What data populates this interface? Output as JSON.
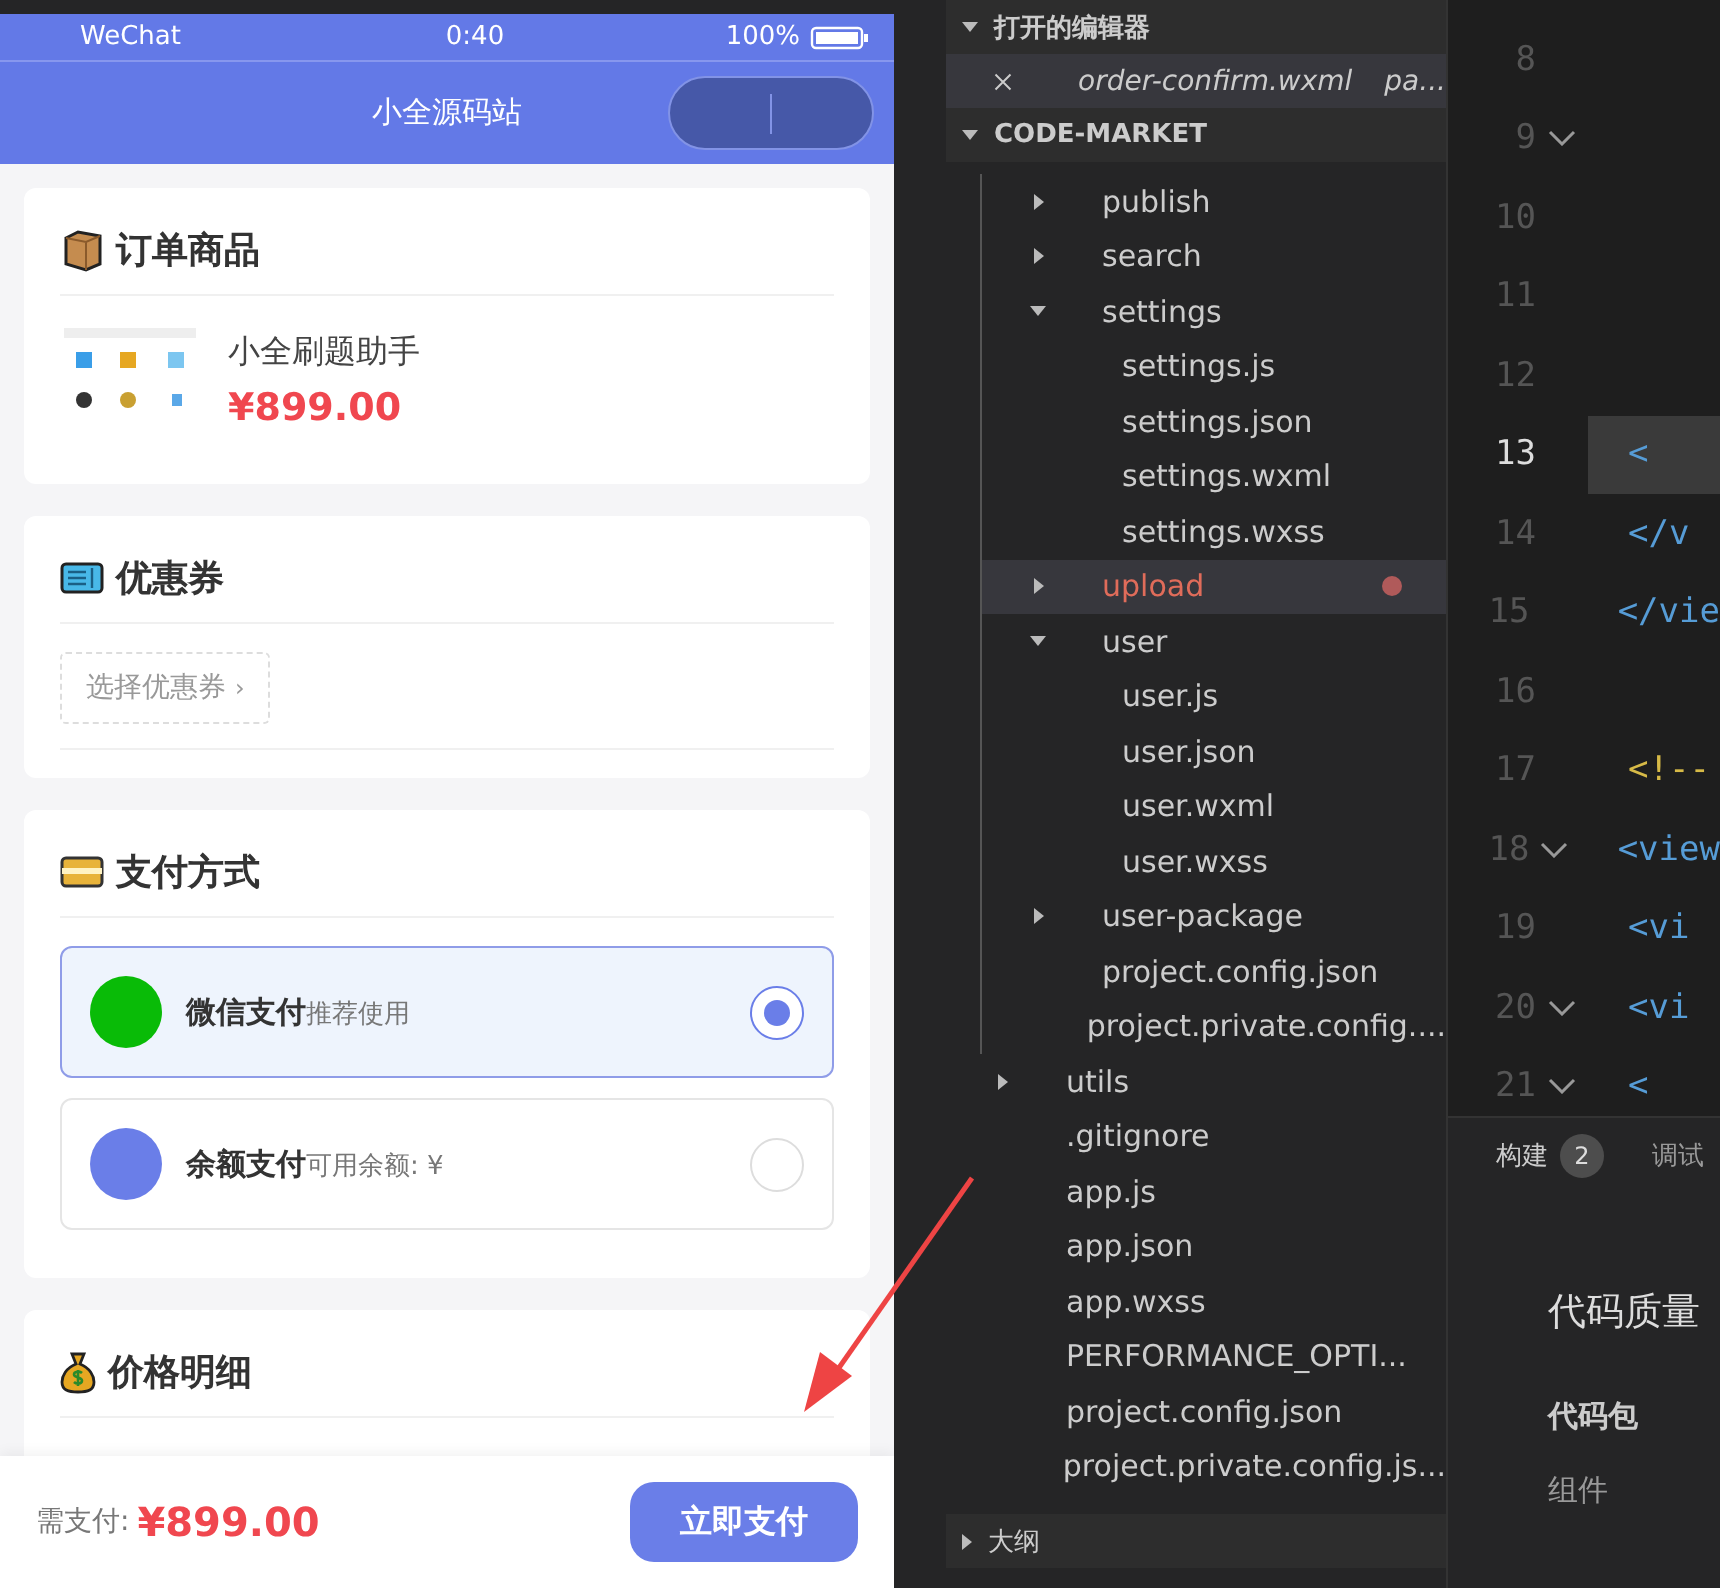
{
  "phone": {
    "status_bar": {
      "carrier": "WeChat",
      "time": "0:40",
      "battery": "100%"
    },
    "nav_title": "小全源码站",
    "sections": [
      {
        "kind": "product",
        "title": "订单商品",
        "product": {
          "name": "小全刷题助手",
          "price": "¥899.00"
        }
      },
      {
        "kind": "coupon",
        "title": "优惠券",
        "coupon_button": "选择优惠券",
        "chevron": "›"
      },
      {
        "kind": "payment",
        "title": "支付方式",
        "options": [
          {
            "name": "微信支付",
            "note": "推荐使用",
            "color": "#09bb07",
            "selected": true
          },
          {
            "name": "余额支付",
            "note": "可用余额: ¥",
            "color": "#6a7ee8",
            "selected": false
          }
        ]
      },
      {
        "kind": "price",
        "title": "价格明细"
      }
    ],
    "footer": {
      "label": "需支付:",
      "amount": "¥899.00",
      "pay_button": "立即支付"
    }
  },
  "explorer": {
    "open_editors": {
      "title": "打开的编辑器",
      "expanded": true,
      "files": [
        {
          "name": "order-confirm.wxml",
          "path": "pa..."
        }
      ]
    },
    "project": {
      "title": "CODE-MARKET",
      "expanded": true,
      "inner_items": [
        {
          "label": "publish",
          "kind": "folder",
          "expanded": false
        },
        {
          "label": "search",
          "kind": "folder",
          "expanded": false
        },
        {
          "label": "settings",
          "kind": "folder",
          "expanded": true,
          "children": [
            {
              "label": "settings.js",
              "kind": "file"
            },
            {
              "label": "settings.json",
              "kind": "file"
            },
            {
              "label": "settings.wxml",
              "kind": "file"
            },
            {
              "label": "settings.wxss",
              "kind": "file"
            }
          ]
        },
        {
          "label": "upload",
          "kind": "folder",
          "expanded": false,
          "modified": true
        },
        {
          "label": "user",
          "kind": "folder",
          "expanded": true,
          "children": [
            {
              "label": "user.js",
              "kind": "file"
            },
            {
              "label": "user.json",
              "kind": "file"
            },
            {
              "label": "user.wxml",
              "kind": "file"
            },
            {
              "label": "user.wxss",
              "kind": "file"
            }
          ]
        },
        {
          "label": "user-package",
          "kind": "folder",
          "expanded": false
        },
        {
          "label": "project.config.json",
          "kind": "file"
        },
        {
          "label": "project.private.config....",
          "kind": "file"
        }
      ],
      "outer_items": [
        {
          "label": "utils",
          "kind": "folder",
          "expanded": false
        },
        {
          "label": ".gitignore",
          "kind": "file"
        },
        {
          "label": "app.js",
          "kind": "file"
        },
        {
          "label": "app.json",
          "kind": "file"
        },
        {
          "label": "app.wxss",
          "kind": "file"
        },
        {
          "label": "PERFORMANCE_OPTI...",
          "kind": "file"
        },
        {
          "label": "project.config.json",
          "kind": "file"
        },
        {
          "label": "project.private.config.js...",
          "kind": "file"
        }
      ]
    },
    "outline": {
      "title": "大纲",
      "expanded": false
    }
  },
  "editor": {
    "lines": [
      {
        "number": "8",
        "fold": false,
        "current": false
      },
      {
        "number": "9",
        "fold": true,
        "current": false
      },
      {
        "number": "10",
        "fold": false,
        "current": false
      },
      {
        "number": "11",
        "fold": false,
        "current": false
      },
      {
        "number": "12",
        "fold": false,
        "current": false
      },
      {
        "number": "13",
        "code": "<",
        "fold": false,
        "current": true
      },
      {
        "number": "14",
        "code": "</v",
        "fold": false,
        "current": false
      },
      {
        "number": "15",
        "code": "</vie",
        "fold": false,
        "current": false
      },
      {
        "number": "16",
        "fold": false,
        "current": false
      },
      {
        "number": "17",
        "code": "<!--",
        "fold": false,
        "current": false,
        "kind": "comment"
      },
      {
        "number": "18",
        "code": "<view",
        "fold": true,
        "current": false
      },
      {
        "number": "19",
        "code": "<vi",
        "fold": false,
        "current": false
      },
      {
        "number": "20",
        "code": "<vi",
        "fold": true,
        "current": false
      },
      {
        "number": "21",
        "code": "<",
        "fold": true,
        "current": false
      }
    ],
    "panel": {
      "tabs": [
        {
          "label": "构建",
          "badge": "2",
          "selected": true
        },
        {
          "label": "调试",
          "selected": false
        }
      ],
      "heading": "代码质量",
      "subheading": "代码包",
      "item": "组件"
    }
  }
}
